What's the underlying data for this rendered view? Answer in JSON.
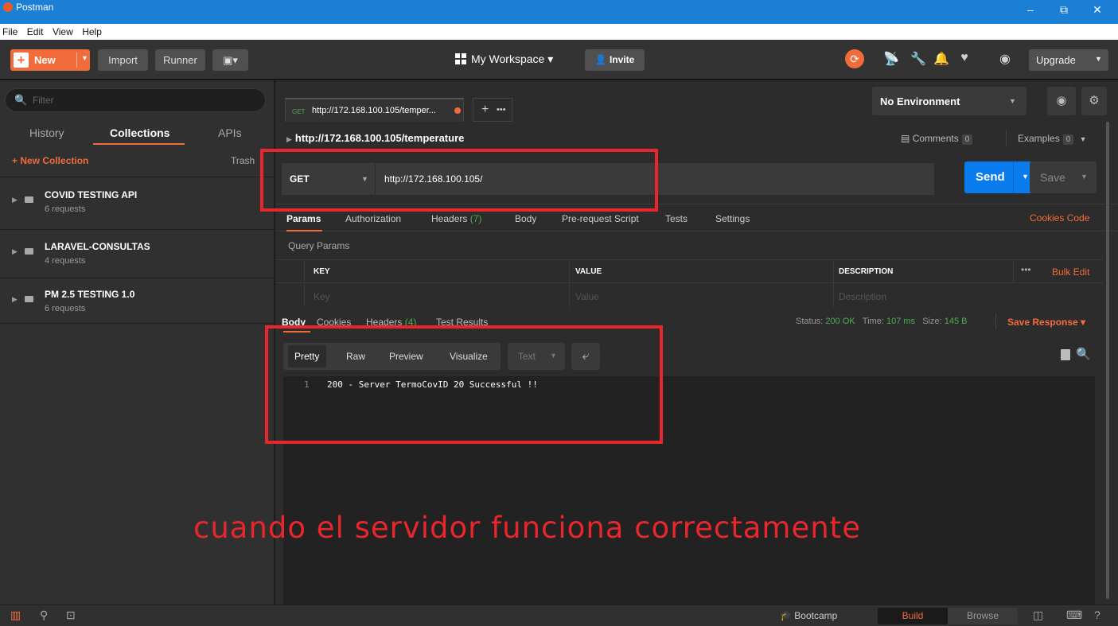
{
  "window": {
    "title": "Postman",
    "minimize": "–",
    "maximize": "⧉",
    "close": "✕"
  },
  "menu": [
    "File",
    "Edit",
    "View",
    "Help"
  ],
  "header": {
    "new_label": "New",
    "import_label": "Import",
    "runner_label": "Runner",
    "workspace_label": "My Workspace ▾",
    "invite_label": "Invite",
    "upgrade_label": "Upgrade"
  },
  "sidebar": {
    "filter_placeholder": "Filter",
    "tabs": [
      "History",
      "Collections",
      "APIs"
    ],
    "new_collection_label": "+ New Collection",
    "trash_label": "Trash",
    "collections": [
      {
        "name": "COVID TESTING API",
        "count": "6 requests"
      },
      {
        "name": "LARAVEL-CONSULTAS",
        "count": "4 requests"
      },
      {
        "name": "PM 2.5 TESTING 1.0",
        "count": "6 requests"
      }
    ]
  },
  "request_tab": {
    "method": "GET",
    "url": "http://172.168.100.105/temper..."
  },
  "environment": {
    "selected": "No Environment"
  },
  "breadcrumb": "http://172.168.100.105/temperature",
  "comments": {
    "label": "Comments",
    "count": "0"
  },
  "examples": {
    "label": "Examples",
    "count": "0"
  },
  "request": {
    "method": "GET",
    "url": "http://172.168.100.105/",
    "send_label": "Send",
    "save_label": "Save"
  },
  "request_tabs": {
    "params": "Params",
    "authorization": "Authorization",
    "headers": "Headers",
    "headers_count": "(7)",
    "body": "Body",
    "prerequest": "Pre-request Script",
    "tests": "Tests",
    "settings": "Settings",
    "cookies_code": "Cookies  Code"
  },
  "query_params": {
    "title": "Query Params",
    "headers": [
      "KEY",
      "VALUE",
      "DESCRIPTION"
    ],
    "placeholders": [
      "Key",
      "Value",
      "Description"
    ],
    "dots": "•••",
    "bulk_edit": "Bulk Edit"
  },
  "response": {
    "tabs": {
      "body": "Body",
      "cookies": "Cookies",
      "headers": "Headers",
      "headers_count": "(4)",
      "tests": "Test Results"
    },
    "status_label": "Status:",
    "status_value": "200 OK",
    "time_label": "Time:",
    "time_value": "107 ms",
    "size_label": "Size:",
    "size_value": "145 B",
    "save_response": "Save Response ▾",
    "views": [
      "Pretty",
      "Raw",
      "Preview",
      "Visualize"
    ],
    "type": "Text",
    "line_number": "1",
    "code": "200 - Server TermoCovID 20 Successful !!"
  },
  "annotation": {
    "caption": "cuando el servidor funciona correctamente"
  },
  "footer": {
    "bootcamp": "Bootcamp",
    "build": "Build",
    "browse": "Browse"
  },
  "colors": {
    "accent": "#f26b3a",
    "send": "#097bed",
    "annotation": "#e8262c",
    "titlebar": "#1c7fd6"
  }
}
